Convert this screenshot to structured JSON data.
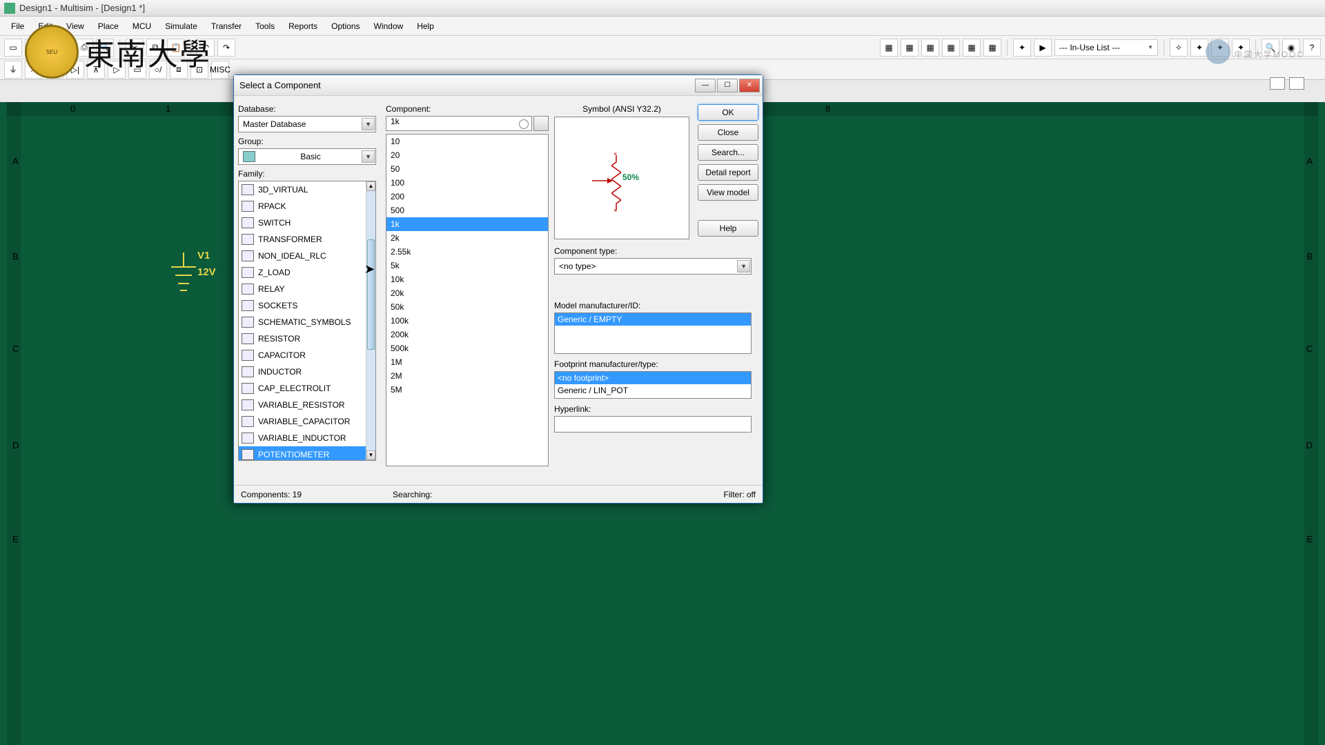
{
  "window": {
    "title": "Design1 - Multisim - [Design1 *]"
  },
  "menu": [
    "File",
    "Edit",
    "View",
    "Place",
    "MCU",
    "Simulate",
    "Transfer",
    "Tools",
    "Reports",
    "Options",
    "Window",
    "Help"
  ],
  "toolbar": {
    "inuse": "--- In-Use List ---"
  },
  "watermark": {
    "uni": "東南大學",
    "mooc": "中国大学MOOC"
  },
  "canvas": {
    "cols": [
      "0",
      "1",
      "8"
    ],
    "rows": [
      "A",
      "B",
      "C",
      "D",
      "E"
    ],
    "v1_name": "V1",
    "v1_val": "12V"
  },
  "dialog": {
    "title": "Select a Component",
    "labels": {
      "database": "Database:",
      "group": "Group:",
      "family": "Family:",
      "component": "Component:",
      "symbol": "Symbol (ANSI Y32.2)",
      "comp_type": "Component type:",
      "model_mfg": "Model manufacturer/ID:",
      "footprint": "Footprint manufacturer/type:",
      "hyperlink": "Hyperlink:"
    },
    "database_value": "Master Database",
    "group_value": "Basic",
    "families": [
      "3D_VIRTUAL",
      "RPACK",
      "SWITCH",
      "TRANSFORMER",
      "NON_IDEAL_RLC",
      "Z_LOAD",
      "RELAY",
      "SOCKETS",
      "SCHEMATIC_SYMBOLS",
      "RESISTOR",
      "CAPACITOR",
      "INDUCTOR",
      "CAP_ELECTROLIT",
      "VARIABLE_RESISTOR",
      "VARIABLE_CAPACITOR",
      "VARIABLE_INDUCTOR",
      "POTENTIOMETER"
    ],
    "family_selected": "POTENTIOMETER",
    "search_value": "1k",
    "components": [
      "10",
      "20",
      "50",
      "100",
      "200",
      "500",
      "1k",
      "2k",
      "2.55k",
      "5k",
      "10k",
      "20k",
      "50k",
      "100k",
      "200k",
      "500k",
      "1M",
      "2M",
      "5M"
    ],
    "component_selected": "1k",
    "symbol_pct": "50%",
    "comp_type_value": "<no type>",
    "model_items": [
      "Generic / EMPTY"
    ],
    "model_selected": "Generic / EMPTY",
    "footprint_items": [
      "<no footprint>",
      "Generic / LIN_POT"
    ],
    "footprint_selected": "<no footprint>",
    "buttons": {
      "ok": "OK",
      "close": "Close",
      "search": "Search...",
      "detail": "Detail report",
      "view": "View model",
      "help": "Help"
    },
    "status": {
      "count": "Components: 19",
      "searching": "Searching:",
      "filter": "Filter: off"
    }
  }
}
